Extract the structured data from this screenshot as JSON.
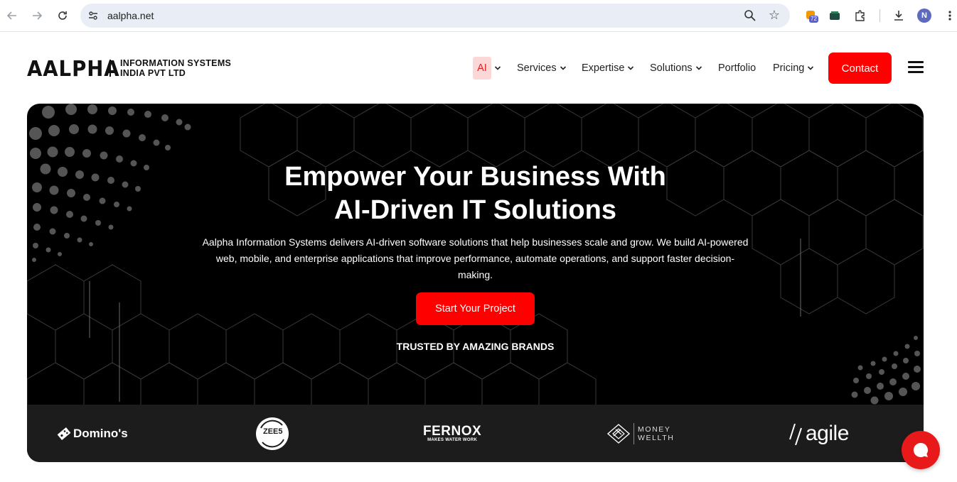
{
  "browser": {
    "url": "aalpha.net",
    "extension_badge": "72",
    "profile_initial": "N"
  },
  "header": {
    "logo_main": "AALPHA",
    "logo_sub_line1": "INFORMATION SYSTEMS",
    "logo_sub_line2": "INDIA PVT LTD",
    "nav": {
      "ai": "AI",
      "services": "Services",
      "expertise": "Expertise",
      "solutions": "Solutions",
      "portfolio": "Portfolio",
      "pricing": "Pricing"
    },
    "contact_label": "Contact"
  },
  "hero": {
    "title_line1": "Empower Your Business With",
    "title_line2": "AI-Driven IT Solutions",
    "description": "Aalpha Information Systems delivers AI-driven software solutions that help businesses scale and grow. We build AI-powered web, mobile, and enterprise applications that improve performance, automate operations, and support faster decision-making.",
    "cta_label": "Start Your Project",
    "trusted_label": "TRUSTED BY AMAZING BRANDS"
  },
  "brands": {
    "dominos": "Domino's",
    "zee5": "ZEE5",
    "fernox": "FERNOX",
    "fernox_tagline": "MAKES WATER WORK",
    "money_line1": "MONEY",
    "money_line2": "WELLTH",
    "agile": "agile"
  },
  "colors": {
    "accent": "#ff0000",
    "hero_bg": "#000000",
    "brand_strip": "#1c1c1c",
    "ai_highlight": "#fcd7d7"
  }
}
